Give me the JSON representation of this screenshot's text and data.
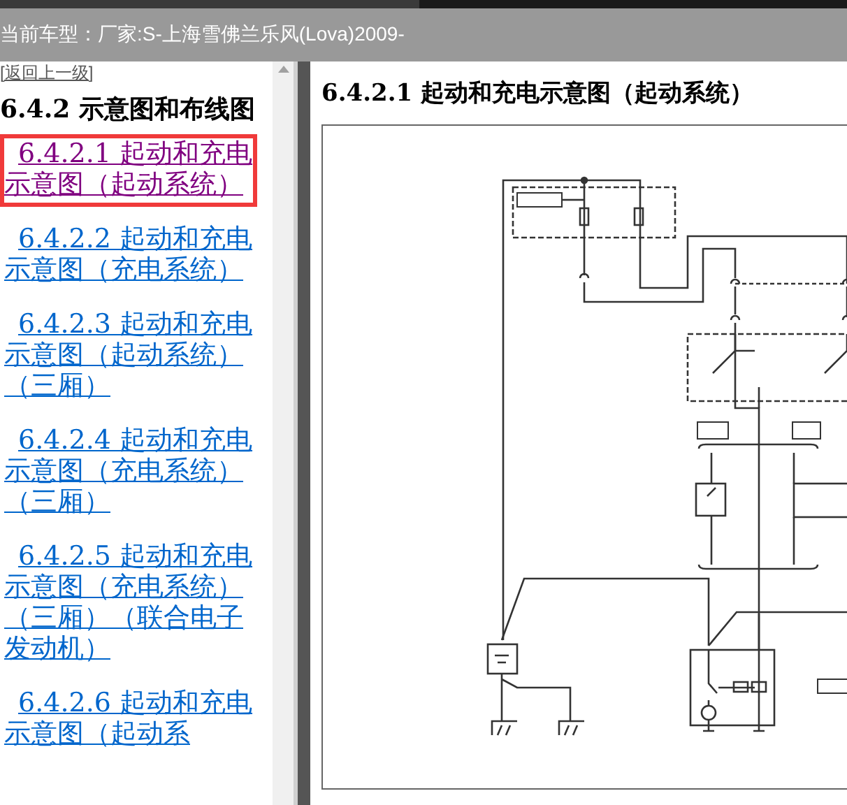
{
  "header": {
    "title": "当前车型：厂家:S-上海雪佛兰乐风(Lova)2009-"
  },
  "sidebar": {
    "back_link": "[返回上一级]",
    "heading": "6.4.2 示意图和布线图",
    "items": [
      {
        "label": "6.4.2.1 起动和充电示意图（起动系统）",
        "selected": true
      },
      {
        "label": "6.4.2.2 起动和充电示意图（充电系统）",
        "selected": false
      },
      {
        "label": "6.4.2.3 起动和充电示意图（起动系统）（三厢）",
        "selected": false
      },
      {
        "label": "6.4.2.4 起动和充电示意图（充电系统）（三厢）",
        "selected": false
      },
      {
        "label": "6.4.2.5 起动和充电示意图（充电系统）（三厢）（联合电子发动机）",
        "selected": false
      },
      {
        "label": "6.4.2.6 起动和充电示意图（起动系",
        "selected": false
      }
    ]
  },
  "content": {
    "title": "6.4.2.1 起动和充电示意图（起动系统）"
  }
}
